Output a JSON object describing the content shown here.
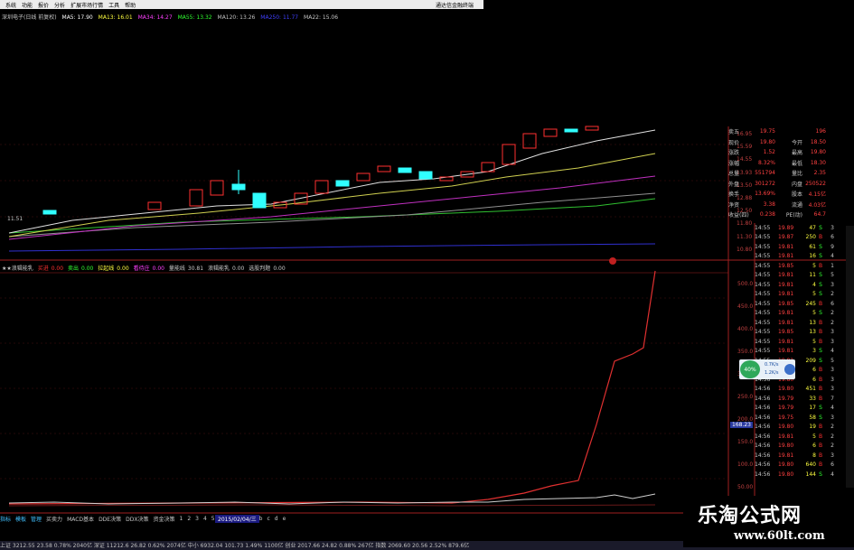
{
  "menubar": {
    "items": [
      "系统",
      "功能",
      "报价",
      "分析",
      "扩展市场行情",
      "工具",
      "帮助"
    ],
    "app_title": "通达信金融终端"
  },
  "ma_legend": {
    "stock": "深圳电子(日线 前复权)",
    "ma5": "MA5: 17.90",
    "ma13": "MA13: 16.01",
    "ma34": "MA34: 14.27",
    "ma55": "MA55: 13.32",
    "ma120": "MA120: 13.26",
    "ma250": "MA250: 11.77",
    "ma22": "MA22: 15.06"
  },
  "indicator_legend": {
    "name": "★★浪辑能乳",
    "items": [
      {
        "label": "买进",
        "value": "0.00",
        "color": "#ff3030"
      },
      {
        "label": "卖出",
        "value": "0.00",
        "color": "#30ff30"
      },
      {
        "label": "拉起线",
        "value": "0.00",
        "color": "#ffff40"
      },
      {
        "label": "看待庄",
        "value": "0.00",
        "color": "#ff40ff"
      },
      {
        "label": "量能线",
        "value": "30.81",
        "color": "#c8c8c8"
      },
      {
        "label": "浪辑能乳",
        "value": "0.00",
        "color": "#c8c8c8"
      },
      {
        "label": "选股判题",
        "value": "0.00",
        "color": "#c8c8c8"
      }
    ]
  },
  "price_axis": [
    "16.95",
    "15.59",
    "14.55",
    "13.93",
    "13.50",
    "12.88",
    "12.50",
    "11.80",
    "11.30",
    "10.80",
    "10.00"
  ],
  "indicator_axis": [
    "500.0",
    "450.0",
    "400.0",
    "350.0",
    "300.0",
    "250.0",
    "200.0",
    "150.0",
    "100.0",
    "50.00"
  ],
  "indicator_axis_highlight": "168.23",
  "left_price_marker": "11.51",
  "quote_panel": {
    "rows": [
      {
        "l": "卖五",
        "v": "19.75",
        "l2": "",
        "v2": "196"
      },
      {
        "l": "现价",
        "v": "19.80",
        "l2": "今开",
        "v2": "18.50"
      },
      {
        "l": "涨跌",
        "v": "1.52",
        "l2": "最高",
        "v2": "19.80"
      },
      {
        "l": "涨幅",
        "v": "8.32%",
        "l2": "最低",
        "v2": "18.30"
      },
      {
        "l": "总量",
        "v": "551794",
        "l2": "量比",
        "v2": "2.35"
      },
      {
        "l": "外盘",
        "v": "301272",
        "l2": "内盘",
        "v2": "250522"
      },
      {
        "l": "换手",
        "v": "13.69%",
        "l2": "股本",
        "v2": "4.15亿"
      },
      {
        "l": "净资",
        "v": "3.38",
        "l2": "流通",
        "v2": "4.03亿"
      },
      {
        "l": "收益(四)",
        "v": "0.238",
        "l2": "PE(动)",
        "v2": "64.7"
      }
    ]
  },
  "trades": [
    {
      "t": "14:55",
      "p": "19.89",
      "v": "47",
      "s": "S",
      "n": "3"
    },
    {
      "t": "14:55",
      "p": "19.87",
      "v": "250",
      "s": "B",
      "n": "6"
    },
    {
      "t": "14:55",
      "p": "19.81",
      "v": "61",
      "s": "S",
      "n": "9"
    },
    {
      "t": "14:55",
      "p": "19.81",
      "v": "16",
      "s": "S",
      "n": "4"
    },
    {
      "t": "14:55",
      "p": "19.85",
      "v": "5",
      "s": "B",
      "n": "1"
    },
    {
      "t": "14:55",
      "p": "19.81",
      "v": "11",
      "s": "S",
      "n": "5"
    },
    {
      "t": "14:55",
      "p": "19.81",
      "v": "4",
      "s": "S",
      "n": "3"
    },
    {
      "t": "14:55",
      "p": "19.81",
      "v": "5",
      "s": "S",
      "n": "2"
    },
    {
      "t": "14:55",
      "p": "19.85",
      "v": "245",
      "s": "B",
      "n": "6"
    },
    {
      "t": "14:55",
      "p": "19.81",
      "v": "5",
      "s": "S",
      "n": "2"
    },
    {
      "t": "14:55",
      "p": "19.81",
      "v": "13",
      "s": "B",
      "n": "2"
    },
    {
      "t": "14:55",
      "p": "19.85",
      "v": "13",
      "s": "B",
      "n": "3"
    },
    {
      "t": "14:55",
      "p": "19.81",
      "v": "5",
      "s": "B",
      "n": "3"
    },
    {
      "t": "14:55",
      "p": "19.81",
      "v": "3",
      "s": "S",
      "n": "4"
    },
    {
      "t": "14:55",
      "p": "19.81",
      "v": "209",
      "s": "S",
      "n": "5"
    },
    {
      "t": "14:55",
      "p": "19.81",
      "v": "6",
      "s": "B",
      "n": "3"
    },
    {
      "t": "14:56",
      "p": "19.80",
      "v": "6",
      "s": "B",
      "n": "3"
    },
    {
      "t": "14:56",
      "p": "19.80",
      "v": "451",
      "s": "B",
      "n": "3"
    },
    {
      "t": "14:56",
      "p": "19.79",
      "v": "33",
      "s": "B",
      "n": "7"
    },
    {
      "t": "14:56",
      "p": "19.79",
      "v": "17",
      "s": "S",
      "n": "4"
    },
    {
      "t": "14:56",
      "p": "19.75",
      "v": "58",
      "s": "S",
      "n": "3"
    },
    {
      "t": "14:56",
      "p": "19.80",
      "v": "19",
      "s": "B",
      "n": "2"
    },
    {
      "t": "14:56",
      "p": "19.81",
      "v": "5",
      "s": "B",
      "n": "2"
    },
    {
      "t": "14:56",
      "p": "19.80",
      "v": "6",
      "s": "B",
      "n": "2"
    },
    {
      "t": "14:56",
      "p": "19.81",
      "v": "8",
      "s": "B",
      "n": "3"
    },
    {
      "t": "14:56",
      "p": "19.80",
      "v": "640",
      "s": "B",
      "n": "6"
    },
    {
      "t": "14:56",
      "p": "19.80",
      "v": "144",
      "s": "S",
      "n": "4"
    }
  ],
  "widget": {
    "percent": "40%",
    "up": "0.7K/s",
    "down": "1.2K/s"
  },
  "bottom_tabs": [
    "指标",
    "模板",
    "管理",
    "买卖力",
    "MACD基本",
    "DDE决策",
    "DDX决策",
    "资金决策",
    "1",
    "2",
    "3",
    "4",
    "5",
    "6",
    "7",
    "8",
    "9",
    "a",
    "b",
    "c",
    "d",
    "e"
  ],
  "date_label": "2015/02/04/三",
  "status_bar": "上证 3212.55  23.58  0.78%  2040亿   深证 11212.6  26.82  0.62%  2074亿   中小 6932.04  101.73  1.49%  1100亿   创业 2017.66  24.82  0.88%  267亿   指数 2069.60  20.56  2.52%  879.6亿",
  "watermark": {
    "cn": "乐淘公式网",
    "url": "www.60lt.com"
  },
  "colors": {
    "up": "#ff3030",
    "down": "#30ffff",
    "ma5": "#ffffff",
    "ma13": "#ffff40",
    "ma34": "#ff40ff",
    "ma55": "#30ff30",
    "ma120": "#c0c0c0",
    "ma250": "#4040ff"
  }
}
